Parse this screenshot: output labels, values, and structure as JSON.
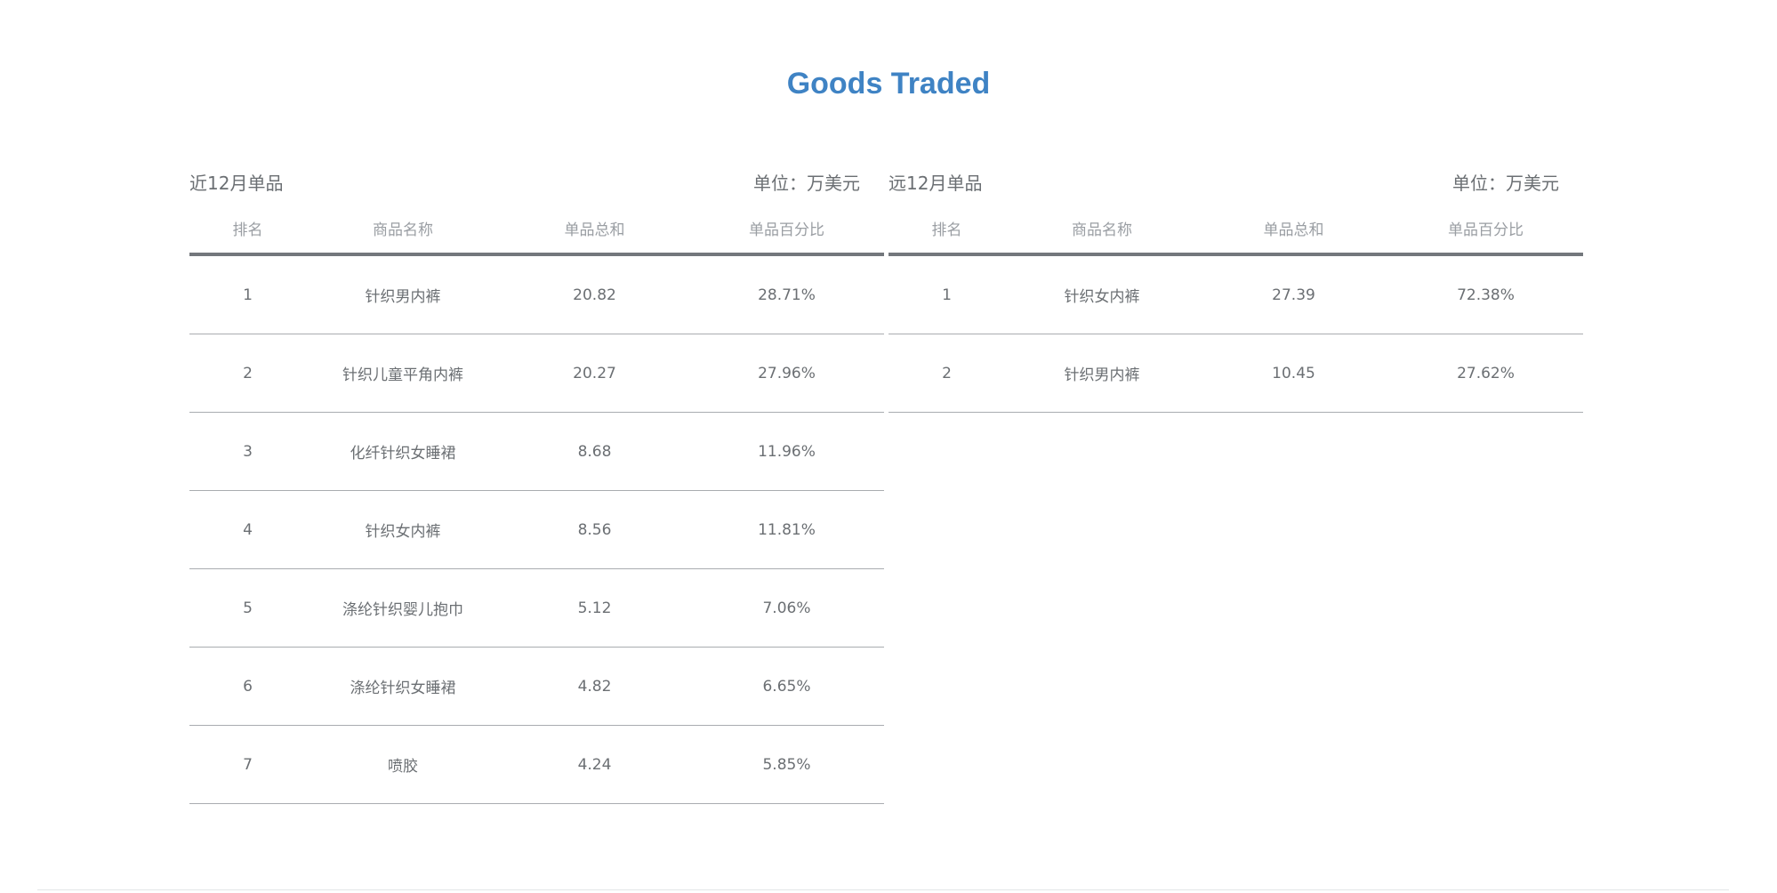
{
  "page": {
    "title": "Goods Traded"
  },
  "left_table": {
    "caption": "近12月单品",
    "unit": "单位：万美元",
    "headers": [
      "排名",
      "商品名称",
      "单品总和",
      "单品百分比"
    ],
    "rows": [
      [
        "1",
        "针织男内裤",
        "20.82",
        "28.71%"
      ],
      [
        "2",
        "针织儿童平角内裤",
        "20.27",
        "27.96%"
      ],
      [
        "3",
        "化纤针织女睡裙",
        "8.68",
        "11.96%"
      ],
      [
        "4",
        "针织女内裤",
        "8.56",
        "11.81%"
      ],
      [
        "5",
        "涤纶针织婴儿抱巾",
        "5.12",
        "7.06%"
      ],
      [
        "6",
        "涤纶针织女睡裙",
        "4.82",
        "6.65%"
      ],
      [
        "7",
        "喷胶",
        "4.24",
        "5.85%"
      ]
    ]
  },
  "right_table": {
    "caption": "远12月单品",
    "unit": "单位：万美元",
    "headers": [
      "排名",
      "商品名称",
      "单品总和",
      "单品百分比"
    ],
    "rows": [
      [
        "1",
        "针织女内裤",
        "27.39",
        "72.38%"
      ],
      [
        "2",
        "针织男内裤",
        "10.45",
        "27.62%"
      ]
    ]
  },
  "colors": {
    "title": "#3f83c4",
    "text": "#6b6f73",
    "header_text": "#9a9ea3",
    "header_rule": "#73777c",
    "row_rule": "#a9acb0"
  }
}
